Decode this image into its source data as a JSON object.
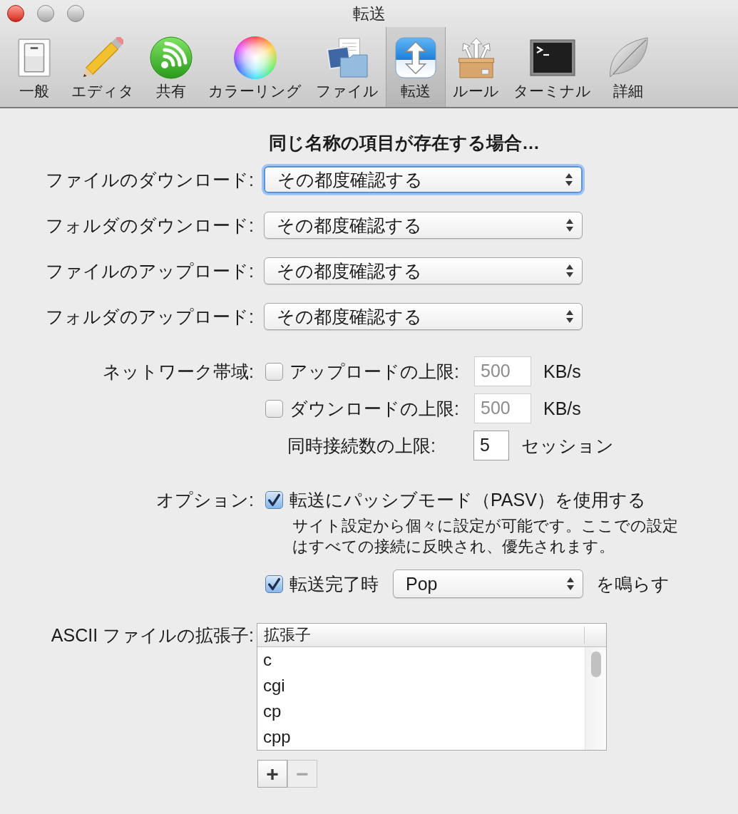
{
  "window": {
    "title": "転送"
  },
  "toolbar": [
    {
      "label": "一般",
      "selected": false
    },
    {
      "label": "エディタ",
      "selected": false
    },
    {
      "label": "共有",
      "selected": false
    },
    {
      "label": "カラーリング",
      "selected": false
    },
    {
      "label": "ファイル",
      "selected": false
    },
    {
      "label": "転送",
      "selected": true
    },
    {
      "label": "ルール",
      "selected": false
    },
    {
      "label": "ターミナル",
      "selected": false
    },
    {
      "label": "詳細",
      "selected": false
    }
  ],
  "conflicts": {
    "heading": "同じ名称の項目が存在する場合…",
    "rows": [
      {
        "label": "ファイルのダウンロード:",
        "value": "その都度確認する",
        "focused": true
      },
      {
        "label": "フォルダのダウンロード:",
        "value": "その都度確認する",
        "focused": false
      },
      {
        "label": "ファイルのアップロード:",
        "value": "その都度確認する",
        "focused": false
      },
      {
        "label": "フォルダのアップロード:",
        "value": "その都度確認する",
        "focused": false
      }
    ]
  },
  "bandwidth": {
    "label": "ネットワーク帯域:",
    "limits": [
      {
        "label": "アップロードの上限:",
        "checked": false,
        "value": "500",
        "unit": "KB/s"
      },
      {
        "label": "ダウンロードの上限:",
        "checked": false,
        "value": "500",
        "unit": "KB/s"
      }
    ],
    "connections": {
      "label": "同時接続数の上限:",
      "value": "5",
      "unit": "セッション"
    }
  },
  "options": {
    "label": "オプション:",
    "passive": {
      "label": "転送にパッシブモード（PASV）を使用する",
      "checked": true,
      "note": "サイト設定から個々に設定が可能です。ここでの設定はすべての接続に反映され、優先されます。"
    },
    "sound": {
      "label": "転送完了時",
      "checked": true,
      "value": "Pop",
      "suffix": "を鳴らす"
    }
  },
  "ascii": {
    "label": "ASCII ファイルの拡張子:",
    "column": "拡張子",
    "rows": [
      "c",
      "cgi",
      "cp",
      "cpp"
    ],
    "buttons": [
      {
        "label": "+",
        "disabled": false
      },
      {
        "label": "−",
        "disabled": true
      }
    ]
  }
}
